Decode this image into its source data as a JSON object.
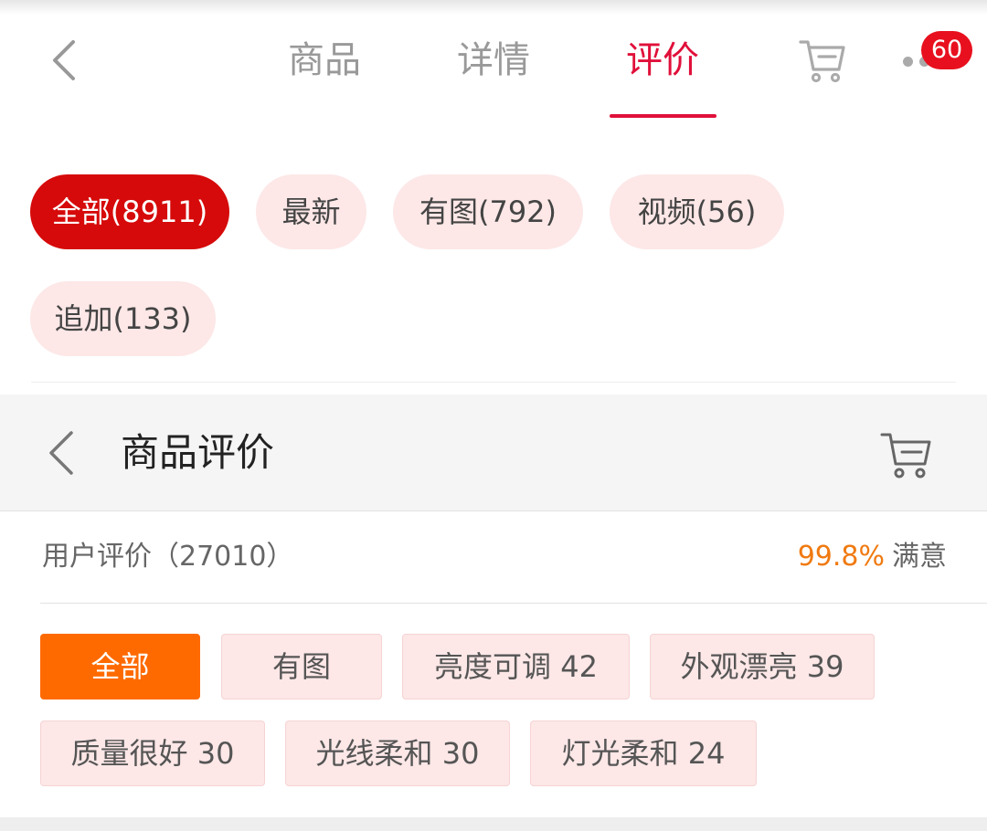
{
  "nav": {
    "tabs": [
      {
        "label": "商品",
        "active": false
      },
      {
        "label": "详情",
        "active": false
      },
      {
        "label": "评价",
        "active": true
      }
    ],
    "cart_badge": "60",
    "accent_color": "#e0103a"
  },
  "filters": [
    {
      "label": "全部(8911)",
      "active": true
    },
    {
      "label": "最新",
      "active": false
    },
    {
      "label": "有图(792)",
      "active": false
    },
    {
      "label": "视频(56)",
      "active": false
    },
    {
      "label": "追加(133)",
      "active": false
    }
  ],
  "section": {
    "title": "商品评价"
  },
  "summary": {
    "label": "用户评价（27010）",
    "satisfaction_rate": "99.8%",
    "satisfaction_label": "满意",
    "rate_color": "#f07a10"
  },
  "tags": [
    {
      "label": "全部",
      "active": true
    },
    {
      "label": "有图",
      "active": false
    },
    {
      "label": "亮度可调 42",
      "active": false
    },
    {
      "label": "外观漂亮 39",
      "active": false
    },
    {
      "label": "质量很好 30",
      "active": false
    },
    {
      "label": "光线柔和 30",
      "active": false
    },
    {
      "label": "灯光柔和 24",
      "active": false
    }
  ]
}
